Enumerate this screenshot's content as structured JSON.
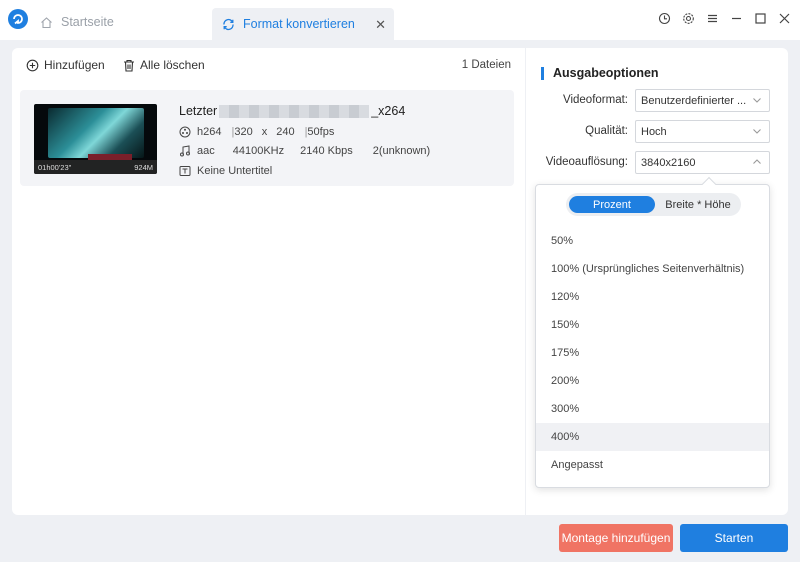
{
  "titlebar": {
    "home_tab": "Startseite",
    "active_tab": "Format konvertieren",
    "close_symbol": "✕"
  },
  "toolbar": {
    "add_label": "Hinzufügen",
    "clear_label": "Alle löschen",
    "file_count": "1 Dateien"
  },
  "file": {
    "name_prefix": "Letzter",
    "name_suffix": "_x264",
    "duration": "01h00'23\"",
    "size": "924M",
    "video_codec": "h264",
    "width": "320",
    "x_sep": "x",
    "height": "240",
    "fps": "50fps",
    "audio_codec": "aac",
    "sample_rate": "44100KHz",
    "bitrate": "2140 Kbps",
    "channels": "2(unknown)",
    "subtitle": "Keine Untertitel",
    "bar_sep": "|"
  },
  "output": {
    "title": "Ausgabeoptionen",
    "format_label": "Videoformat:",
    "format_value": "Benutzerdefinierter ...",
    "quality_label": "Qualität:",
    "quality_value": "Hoch",
    "resolution_label": "Videoauflösung:",
    "resolution_value": "3840x2160"
  },
  "dropdown": {
    "toggle_percent": "Prozent",
    "toggle_wh": "Breite * Höhe",
    "options": [
      "50%",
      "100% (Ursprüngliches Seitenverhältnis)",
      "120%",
      "150%",
      "175%",
      "200%",
      "300%",
      "400%",
      "Angepasst"
    ],
    "hovered_index": 7
  },
  "buttons": {
    "montage": "Montage hinzufügen",
    "start": "Starten"
  },
  "colors": {
    "accent": "#1f7fe0",
    "montage": "#f07464"
  }
}
